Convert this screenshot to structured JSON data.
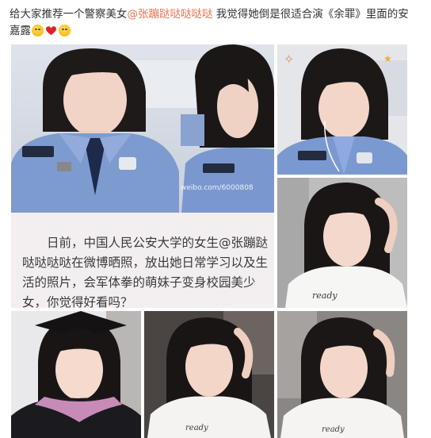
{
  "post": {
    "text_before": "给大家推荐一个警察美女",
    "mention": "@张蹦跶哒哒哒哒",
    "text_after": " 我觉得她倒是很适合演《余罪》里面的安嘉露",
    "emojis": [
      "smirk-face-emoji",
      "heart-emoji",
      "smirk-face-emoji"
    ]
  },
  "images": {
    "caption_text": "日前，中国人民公安大学的女生@张蹦跶哒哒哒哒在微博晒照，放出她日常学习以及生活的照片，会军体拳的萌妹子变身校园美少女，你觉得好看吗？",
    "watermark_text": "weibo.com/6000808"
  },
  "colors": {
    "mention": "#eb7350",
    "uniform_blue": "#7a98cf",
    "hair": "#1e1a1a",
    "caption_bg": "#f3eff1"
  }
}
